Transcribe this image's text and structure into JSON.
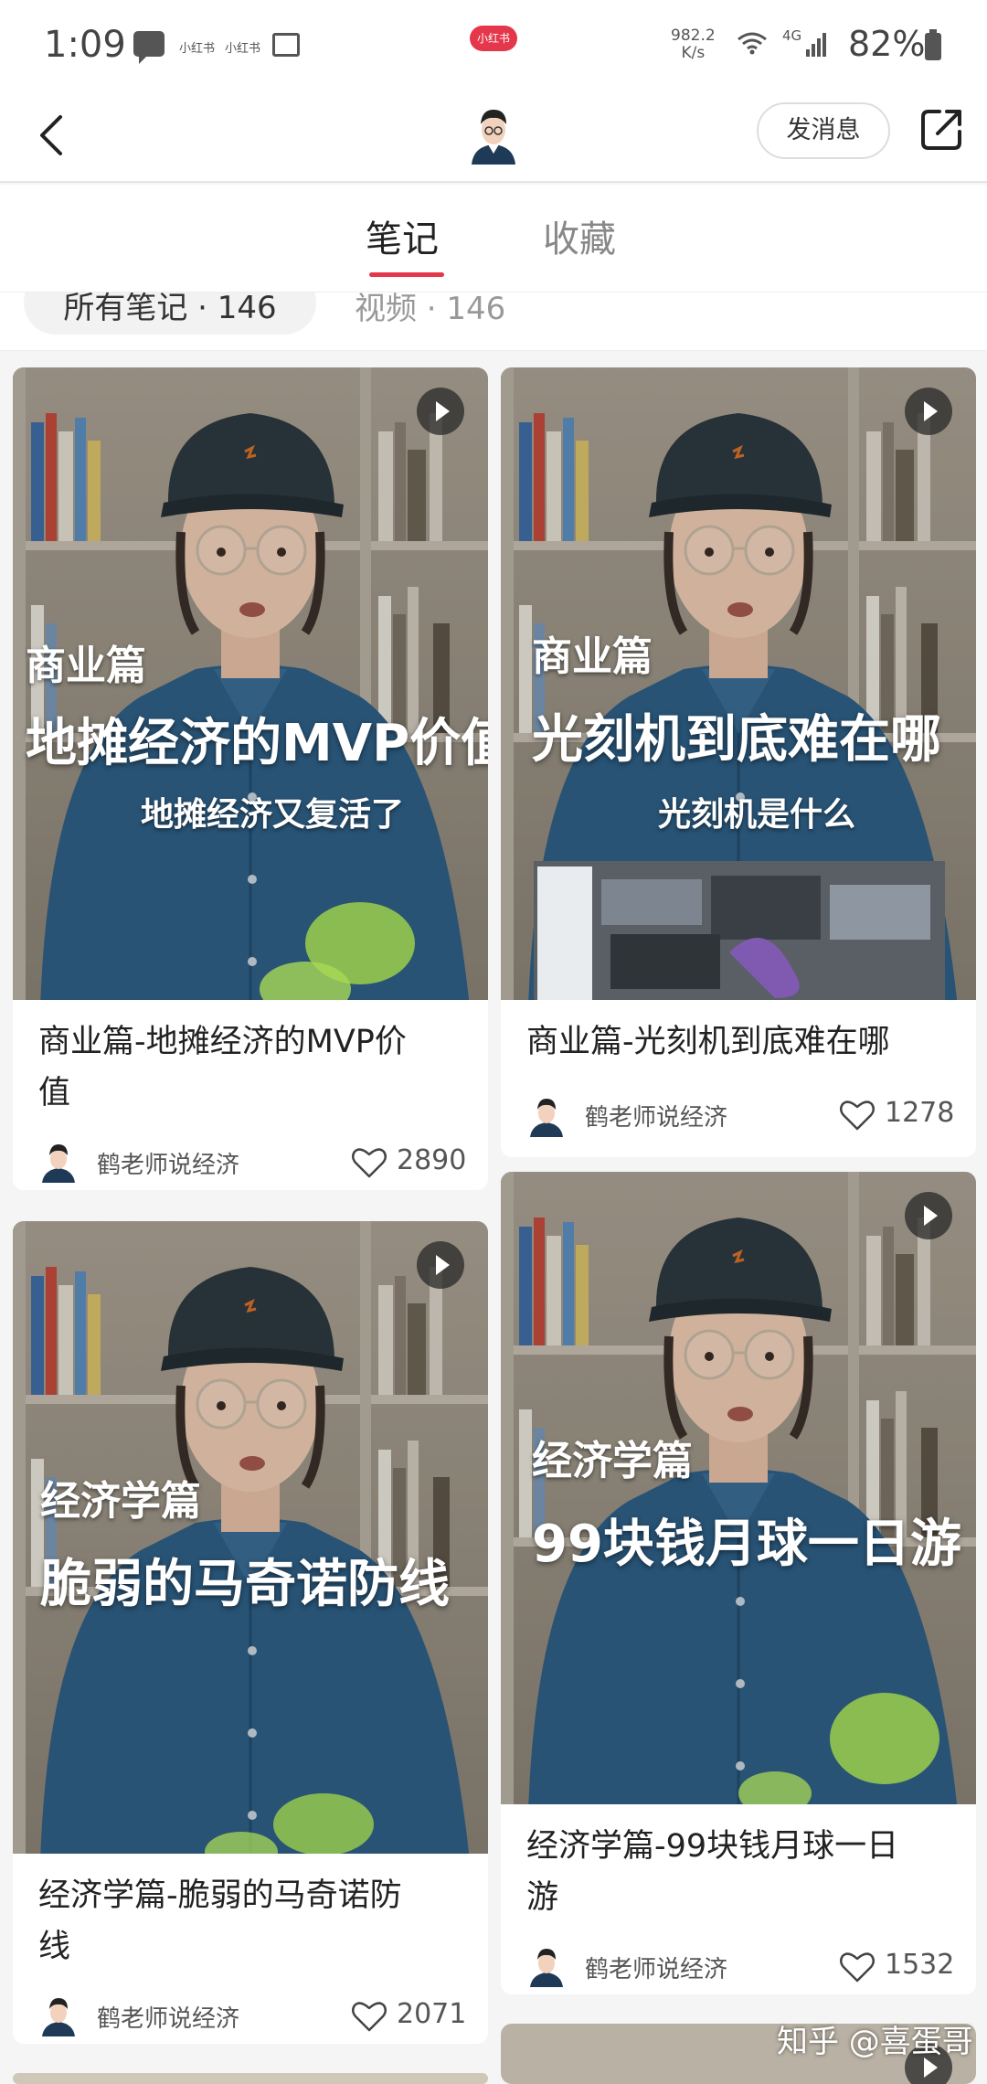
{
  "status_bar": {
    "time": "1:09",
    "app_label_1": "小红书",
    "app_label_2": "小红书",
    "center_badge": "小红书",
    "net_speed_value": "982.2",
    "net_speed_unit": "K/s",
    "network_type": "4G",
    "battery": "82%"
  },
  "header": {
    "message_button": "发消息"
  },
  "tabs": {
    "notes": "笔记",
    "favorites": "收藏"
  },
  "filters": {
    "all": "所有笔记 · 146",
    "video": "视频 · 146"
  },
  "notes": [
    {
      "overlay_category": "商业篇",
      "overlay_title": "地摊经济的MVP价值",
      "overlay_subtitle": "地摊经济又复活了",
      "title_line1": "商业篇-地摊经济的MVP价",
      "title_line2": "值",
      "author": "鹤老师说经济",
      "likes": "2890"
    },
    {
      "overlay_category": "商业篇",
      "overlay_title": "光刻机到底难在哪",
      "overlay_subtitle": "光刻机是什么",
      "title_line1": "商业篇-光刻机到底难在哪",
      "title_line2": "",
      "author": "鹤老师说经济",
      "likes": "1278"
    },
    {
      "overlay_category": "经济学篇",
      "overlay_title": "脆弱的马奇诺防线",
      "overlay_subtitle": "",
      "title_line1": "经济学篇-脆弱的马奇诺防",
      "title_line2": "线",
      "author": "鹤老师说经济",
      "likes": "2071"
    },
    {
      "overlay_category": "经济学篇",
      "overlay_title": "99块钱月球一日游",
      "overlay_subtitle": "",
      "title_line1": "经济学篇-99块钱月球一日",
      "title_line2": "游",
      "author": "鹤老师说经济",
      "likes": "1532"
    }
  ],
  "watermark": "知乎 @喜蛋哥",
  "colors": {
    "accent": "#e5374b",
    "shirt": "#2e5f86",
    "cap": "#2d3a40",
    "background": "#f5f5f5"
  }
}
